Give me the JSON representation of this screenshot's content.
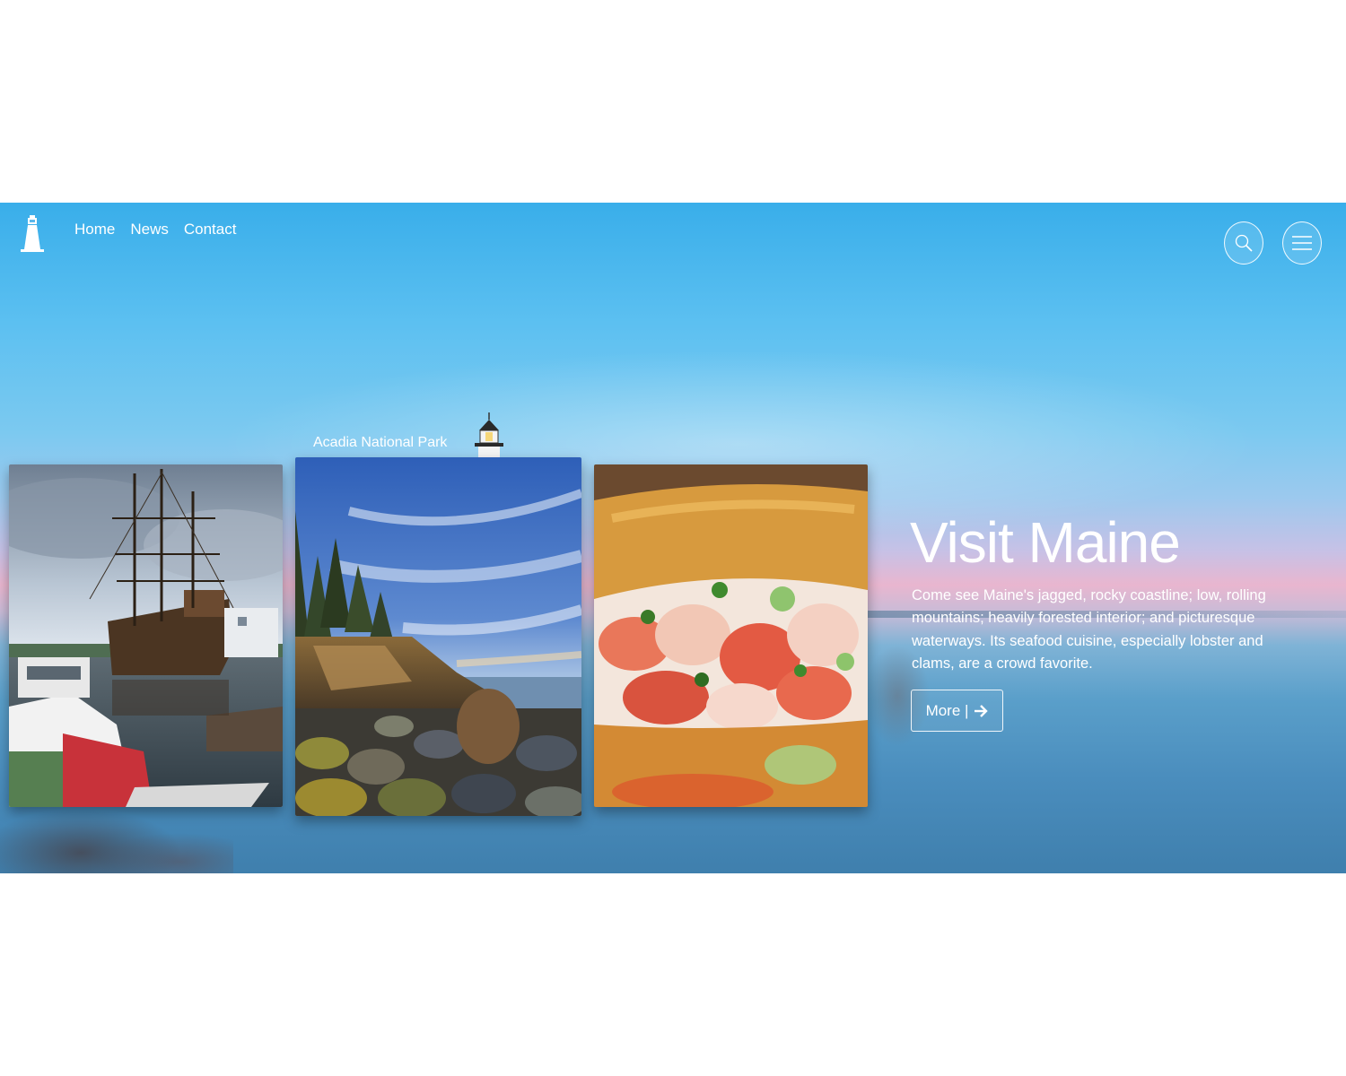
{
  "nav": {
    "logo_icon": "lighthouse-icon",
    "links": [
      "Home",
      "News",
      "Contact"
    ],
    "search_icon": "search-icon",
    "menu_icon": "hamburger-menu-icon"
  },
  "cards": {
    "caption": "Acadia National Park",
    "caption_icon": "lighthouse-icon",
    "items": [
      "ship-harbor-photo",
      "acadia-coast-photo",
      "lobster-roll-photo"
    ]
  },
  "hero": {
    "headline": "Visit Maine",
    "description": "Come see Maine's jagged, rocky coastline; low, rolling mountains; heavily forested interior; and picturesque waterways. Its seafood cuisine, especially lobster and clams, are a crowd favorite.",
    "more_label": "More |",
    "more_icon": "arrow-right-icon"
  },
  "colors": {
    "sky_top": "#39aeea",
    "sky_pink": "#e9b6cf",
    "sea": "#4a8dbd",
    "text": "#ffffff"
  }
}
